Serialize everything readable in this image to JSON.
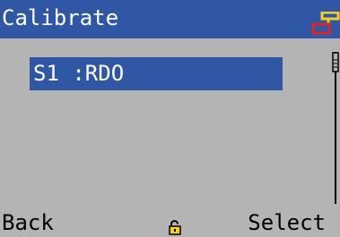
{
  "header": {
    "title": "Calibrate",
    "status_icon": "network-connection-icon"
  },
  "list": {
    "items": [
      {
        "label": "S1 :RDO",
        "selected": true
      }
    ]
  },
  "softkeys": {
    "left_label": "Back",
    "right_label": "Select"
  },
  "status": {
    "icon": "unlocked-padlock-icon"
  },
  "colors": {
    "screen_background": "#b4b4b4",
    "accent": "#2f57a3",
    "highlight_text": "#ffffff",
    "text": "#000000",
    "icon_yellow": "#f2d21c",
    "icon_red": "#d8262a"
  }
}
